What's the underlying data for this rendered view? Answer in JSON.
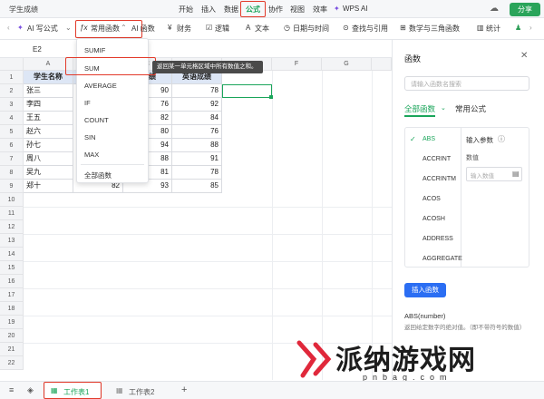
{
  "title_bar": {
    "doc_name": "学生成绩",
    "menu": [
      "开始",
      "插入",
      "数据",
      "公式",
      "协作",
      "视图",
      "效率"
    ],
    "active_menu": "公式",
    "wps_ai": "WPS AI",
    "share": "分享"
  },
  "toolbar": {
    "ai_write": "AI 写公式",
    "common_funcs": "常用函数",
    "ai_funcs": "AI 函数",
    "finance": "财务",
    "logic": "逻辑",
    "text": "文本",
    "datetime": "日期与时间",
    "lookup": "查找与引用",
    "math": "数学与三角函数",
    "stats": "统计"
  },
  "formula_bar": {
    "cell_ref": "E2"
  },
  "columns": [
    "A",
    "B",
    "C",
    "D",
    "E",
    "F",
    "G"
  ],
  "rows": [
    "1",
    "2",
    "3",
    "4",
    "5",
    "6",
    "7",
    "8",
    "9",
    "10",
    "11",
    "12",
    "13",
    "14",
    "15",
    "16",
    "17",
    "18",
    "19",
    "20",
    "21",
    "22"
  ],
  "table": {
    "headers": [
      "学生名称",
      "",
      "成绩",
      "英语成绩"
    ],
    "names": [
      "张三",
      "李四",
      "王五",
      "赵六",
      "孙七",
      "周八",
      "吴九",
      "郑十"
    ],
    "math": [
      "90",
      "76",
      "82",
      "80",
      "94",
      "88",
      "81",
      "93"
    ],
    "english": [
      "78",
      "92",
      "84",
      "76",
      "88",
      "91",
      "78",
      "85"
    ],
    "partial_b9": "82"
  },
  "dropdown": {
    "items": [
      "SUMIF",
      "SUM",
      "AVERAGE",
      "IF",
      "COUNT",
      "SIN",
      "MAX"
    ],
    "all": "全部函数"
  },
  "tooltip": "返回某一单元格区域中所有数值之和。",
  "panel": {
    "title": "函数",
    "search_placeholder": "请输入函数名搜索",
    "tab_all": "全部函数",
    "tab_common": "常用公式",
    "functions": [
      "ABS",
      "ACCRINT",
      "ACCRINTM",
      "ACOS",
      "ACOSH",
      "ADDRESS",
      "AGGREGATE"
    ],
    "param_title": "输入参数",
    "param_label": "数值",
    "param_placeholder": "输入数值",
    "insert_btn": "插入函数",
    "syntax": "ABS(number)",
    "desc": "返回给定数字的绝对值。（即不带符号的数值）"
  },
  "sheets": {
    "sheet1": "工作表1",
    "sheet2": "工作表2"
  },
  "watermark": {
    "text": "派纳游戏网",
    "sub": "pnbag.com"
  },
  "colors": {
    "accent": "#1aa55a",
    "highlight": "#e23a2a",
    "insert_btn": "#2b6ef3"
  }
}
